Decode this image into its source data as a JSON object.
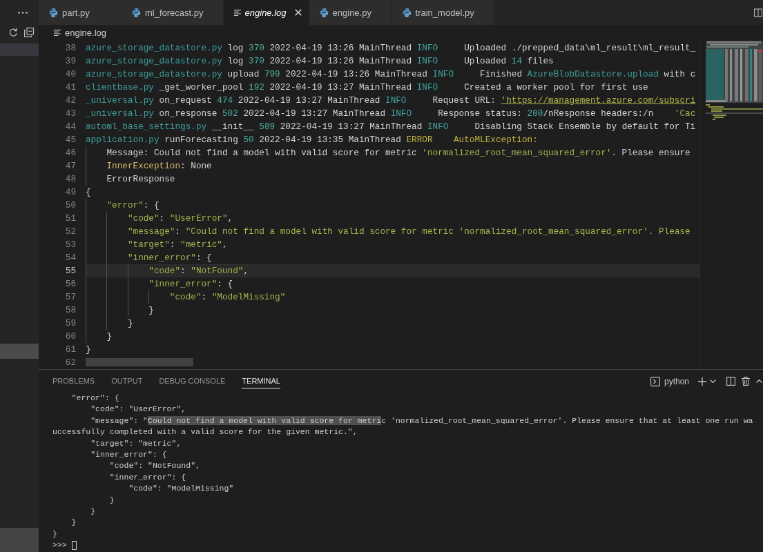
{
  "tabs": [
    {
      "label": "part.py",
      "kind": "python",
      "selected": false,
      "preview": false
    },
    {
      "label": "ml_forecast.py",
      "kind": "python",
      "selected": false,
      "preview": false
    },
    {
      "label": "engine.log",
      "kind": "log",
      "selected": true,
      "preview": true
    },
    {
      "label": "engine.py",
      "kind": "python",
      "selected": false,
      "preview": false
    },
    {
      "label": "train_model.py",
      "kind": "python",
      "selected": false,
      "preview": false
    }
  ],
  "breadcrumb": {
    "label": "engine.log",
    "kind": "log"
  },
  "editor": {
    "lines": [
      {
        "number": "38",
        "current": false,
        "segments": [
          {
            "text": "azure_storage_datastore.py",
            "kind": "file"
          },
          {
            "text": " log ",
            "kind": "text"
          },
          {
            "text": "370",
            "kind": "number"
          },
          {
            "text": " 2022-04-19 13:26 MainThread ",
            "kind": "text"
          },
          {
            "text": "INFO",
            "kind": "info"
          },
          {
            "text": "     Uploaded ./prepped_data\\ml_result\\ml_result_",
            "kind": "text"
          }
        ]
      },
      {
        "number": "39",
        "current": false,
        "segments": [
          {
            "text": "azure_storage_datastore.py",
            "kind": "file"
          },
          {
            "text": " log ",
            "kind": "text"
          },
          {
            "text": "370",
            "kind": "number"
          },
          {
            "text": " 2022-04-19 13:26 MainThread ",
            "kind": "text"
          },
          {
            "text": "INFO",
            "kind": "info"
          },
          {
            "text": "     Uploaded ",
            "kind": "text"
          },
          {
            "text": "14",
            "kind": "number"
          },
          {
            "text": " files",
            "kind": "text"
          }
        ]
      },
      {
        "number": "40",
        "current": false,
        "segments": [
          {
            "text": "azure_storage_datastore.py",
            "kind": "file"
          },
          {
            "text": " upload ",
            "kind": "text"
          },
          {
            "text": "799",
            "kind": "number"
          },
          {
            "text": " 2022-04-19 13:26 MainThread ",
            "kind": "text"
          },
          {
            "text": "INFO",
            "kind": "info"
          },
          {
            "text": "     Finished ",
            "kind": "text"
          },
          {
            "text": "AzureBlobDatastore.upload",
            "kind": "name"
          },
          {
            "text": " with c",
            "kind": "text"
          }
        ]
      },
      {
        "number": "41",
        "current": false,
        "segments": [
          {
            "text": "clientbase.py",
            "kind": "file"
          },
          {
            "text": " _get_worker_pool ",
            "kind": "text"
          },
          {
            "text": "192",
            "kind": "number"
          },
          {
            "text": " 2022-04-19 13:27 MainThread ",
            "kind": "text"
          },
          {
            "text": "INFO",
            "kind": "info"
          },
          {
            "text": "     Created a worker pool for first use",
            "kind": "text"
          }
        ]
      },
      {
        "number": "42",
        "current": false,
        "segments": [
          {
            "text": "_universal.py",
            "kind": "file"
          },
          {
            "text": " on_request ",
            "kind": "text"
          },
          {
            "text": "474",
            "kind": "number"
          },
          {
            "text": " 2022-04-19 13:27 MainThread ",
            "kind": "text"
          },
          {
            "text": "INFO",
            "kind": "info"
          },
          {
            "text": "     Request URL: ",
            "kind": "text"
          },
          {
            "text": "'https://management.azure.com/subscri",
            "kind": "url"
          }
        ]
      },
      {
        "number": "43",
        "current": false,
        "segments": [
          {
            "text": "_universal.py",
            "kind": "file"
          },
          {
            "text": " on_response ",
            "kind": "text"
          },
          {
            "text": "502",
            "kind": "number"
          },
          {
            "text": " 2022-04-19 13:27 MainThread ",
            "kind": "text"
          },
          {
            "text": "INFO",
            "kind": "info"
          },
          {
            "text": "     Response status: ",
            "kind": "text"
          },
          {
            "text": "200",
            "kind": "number"
          },
          {
            "text": "/nResponse headers:/n    ",
            "kind": "text"
          },
          {
            "text": "'Cac",
            "kind": "string"
          }
        ]
      },
      {
        "number": "44",
        "current": false,
        "segments": [
          {
            "text": "automl_base_settings.py",
            "kind": "file"
          },
          {
            "text": " __init__ ",
            "kind": "text"
          },
          {
            "text": "589",
            "kind": "number"
          },
          {
            "text": " 2022-04-19 13:27 MainThread ",
            "kind": "text"
          },
          {
            "text": "INFO",
            "kind": "info"
          },
          {
            "text": "     Disabling Stack Ensemble by default for Ti",
            "kind": "text"
          }
        ]
      },
      {
        "number": "45",
        "current": false,
        "segments": [
          {
            "text": "application.py",
            "kind": "file"
          },
          {
            "text": " runForecasting ",
            "kind": "text"
          },
          {
            "text": "50",
            "kind": "number"
          },
          {
            "text": " 2022-04-19 13:35 MainThread ",
            "kind": "text"
          },
          {
            "text": "ERROR    AutoMLException:",
            "kind": "error"
          }
        ]
      },
      {
        "number": "46",
        "current": false,
        "segments": [
          {
            "text": "    Message: Could not find a model with valid score for metric ",
            "kind": "text"
          },
          {
            "text": "'normalized_root_mean_squared_error'",
            "kind": "string"
          },
          {
            "text": ". Please ensure",
            "kind": "text"
          }
        ]
      },
      {
        "number": "47",
        "current": false,
        "segments": [
          {
            "text": "    InnerException",
            "kind": "key"
          },
          {
            "text": ": None",
            "kind": "text"
          }
        ]
      },
      {
        "number": "48",
        "current": false,
        "segments": [
          {
            "text": "    ErrorResponse",
            "kind": "text"
          }
        ]
      },
      {
        "number": "49",
        "current": false,
        "segments": [
          {
            "text": "{",
            "kind": "text"
          }
        ]
      },
      {
        "number": "50",
        "current": false,
        "segments": [
          {
            "text": "    \"error\"",
            "kind": "string"
          },
          {
            "text": ": {",
            "kind": "text"
          }
        ]
      },
      {
        "number": "51",
        "current": false,
        "segments": [
          {
            "text": "        \"code\"",
            "kind": "string"
          },
          {
            "text": ": ",
            "kind": "text"
          },
          {
            "text": "\"UserError\"",
            "kind": "string"
          },
          {
            "text": ",",
            "kind": "text"
          }
        ]
      },
      {
        "number": "52",
        "current": false,
        "segments": [
          {
            "text": "        \"message\"",
            "kind": "string"
          },
          {
            "text": ": ",
            "kind": "text"
          },
          {
            "text": "\"Could not find a model with valid score for metric 'normalized_root_mean_squared_error'. Please",
            "kind": "string"
          }
        ]
      },
      {
        "number": "53",
        "current": false,
        "segments": [
          {
            "text": "        \"target\"",
            "kind": "string"
          },
          {
            "text": ": ",
            "kind": "text"
          },
          {
            "text": "\"metric\"",
            "kind": "string"
          },
          {
            "text": ",",
            "kind": "text"
          }
        ]
      },
      {
        "number": "54",
        "current": false,
        "segments": [
          {
            "text": "        \"inner_error\"",
            "kind": "string"
          },
          {
            "text": ": {",
            "kind": "text"
          }
        ]
      },
      {
        "number": "55",
        "current": true,
        "segments": [
          {
            "text": "            \"code\"",
            "kind": "string"
          },
          {
            "text": ": ",
            "kind": "text"
          },
          {
            "text": "\"NotFound\"",
            "kind": "string"
          },
          {
            "text": ",",
            "kind": "text"
          }
        ]
      },
      {
        "number": "56",
        "current": false,
        "segments": [
          {
            "text": "            \"inner_error\"",
            "kind": "string"
          },
          {
            "text": ": {",
            "kind": "text"
          }
        ]
      },
      {
        "number": "57",
        "current": false,
        "segments": [
          {
            "text": "                \"code\"",
            "kind": "string"
          },
          {
            "text": ": ",
            "kind": "text"
          },
          {
            "text": "\"ModelMissing\"",
            "kind": "string"
          }
        ]
      },
      {
        "number": "58",
        "current": false,
        "segments": [
          {
            "text": "            }",
            "kind": "text"
          }
        ]
      },
      {
        "number": "59",
        "current": false,
        "segments": [
          {
            "text": "        }",
            "kind": "text"
          }
        ]
      },
      {
        "number": "60",
        "current": false,
        "segments": [
          {
            "text": "    }",
            "kind": "text"
          }
        ]
      },
      {
        "number": "61",
        "current": false,
        "segments": [
          {
            "text": "}",
            "kind": "text"
          }
        ]
      },
      {
        "number": "62",
        "current": false
      }
    ]
  },
  "panel": {
    "tabs": [
      {
        "label": "PROBLEMS",
        "selected": false
      },
      {
        "label": "OUTPUT",
        "selected": false
      },
      {
        "label": "DEBUG CONSOLE",
        "selected": false
      },
      {
        "label": "TERMINAL",
        "selected": true
      }
    ],
    "terminal_selector": "python",
    "terminal": {
      "lines": [
        {
          "text": "    \"error\": {"
        },
        {
          "text": "        \"code\": \"UserError\","
        },
        {
          "segments": [
            {
              "text": "        \"message\": \"",
              "selected": false
            },
            {
              "text": "Could not find a model with valid score for metri",
              "selected": true
            },
            {
              "text": "c 'normalized_root_mean_squared_error'. Please ensure that at least one run wa",
              "selected": false
            }
          ]
        },
        {
          "text": "uccessfully completed with a valid score for the given metric.\","
        },
        {
          "text": "        \"target\": \"metric\","
        },
        {
          "text": "        \"inner_error\": {"
        },
        {
          "text": "            \"code\": \"NotFound\","
        },
        {
          "text": "            \"inner_error\": {"
        },
        {
          "text": "                \"code\": \"ModelMissing\""
        },
        {
          "text": "            }"
        },
        {
          "text": "        }"
        },
        {
          "text": "    }"
        },
        {
          "text": "}"
        }
      ],
      "prompt": ">>>"
    }
  }
}
